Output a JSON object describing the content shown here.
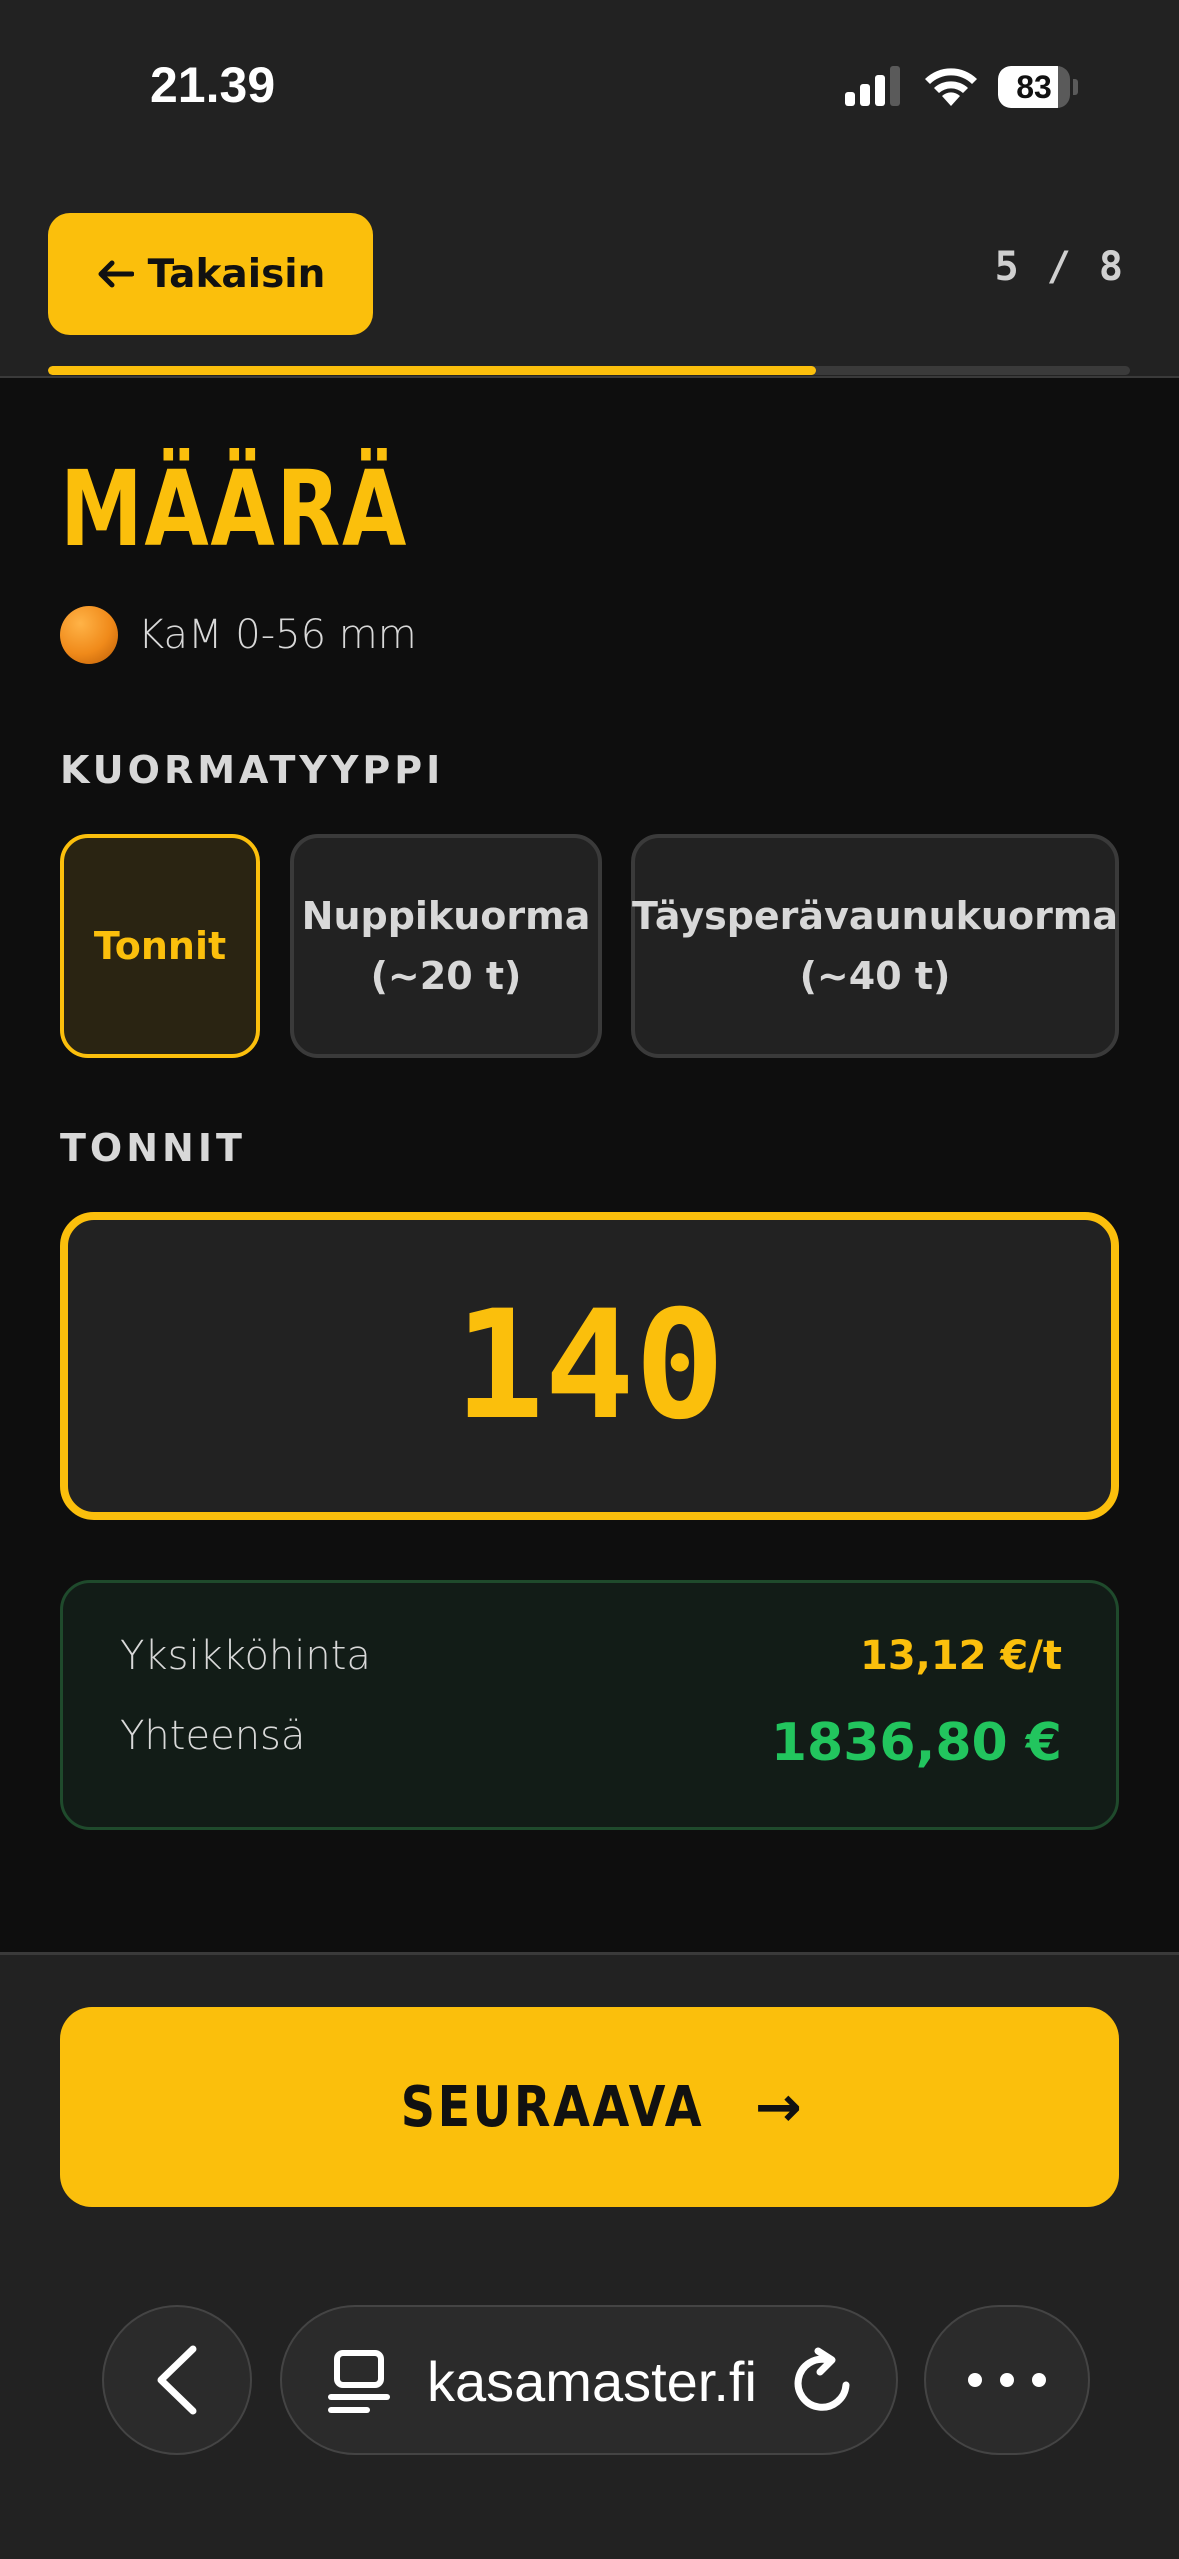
{
  "status_bar": {
    "time": "21.39",
    "battery": "83",
    "battery_level": 0.83
  },
  "header": {
    "back_label": "Takaisin",
    "step": "5 / 8",
    "progress": 0.71
  },
  "page": {
    "title": "MÄÄRÄ",
    "product_name": "KaM 0-56 mm"
  },
  "load_type": {
    "label": "KUORMATYYPPI",
    "options": [
      {
        "line1": "Tonnit",
        "line2": "",
        "selected": true
      },
      {
        "line1": "Nuppikuorma",
        "line2": "(~20 t)",
        "selected": false
      },
      {
        "line1": "Täysperävaunukuorma",
        "line2": "(~40 t)",
        "selected": false
      }
    ]
  },
  "tonnes": {
    "label": "TONNIT",
    "value": "140"
  },
  "price": {
    "unit_price_label": "Yksikköhinta",
    "unit_price_value": "13,12 €/t",
    "total_label": "Yhteensä",
    "total_value": "1836,80 €"
  },
  "footer": {
    "next_label": "SEURAAVA",
    "next_arrow": "→"
  },
  "browser": {
    "url": "kasamaster.fi"
  },
  "colors": {
    "accent": "#fbbf0c",
    "positive": "#22c55e",
    "background": "#0e0e0e"
  }
}
